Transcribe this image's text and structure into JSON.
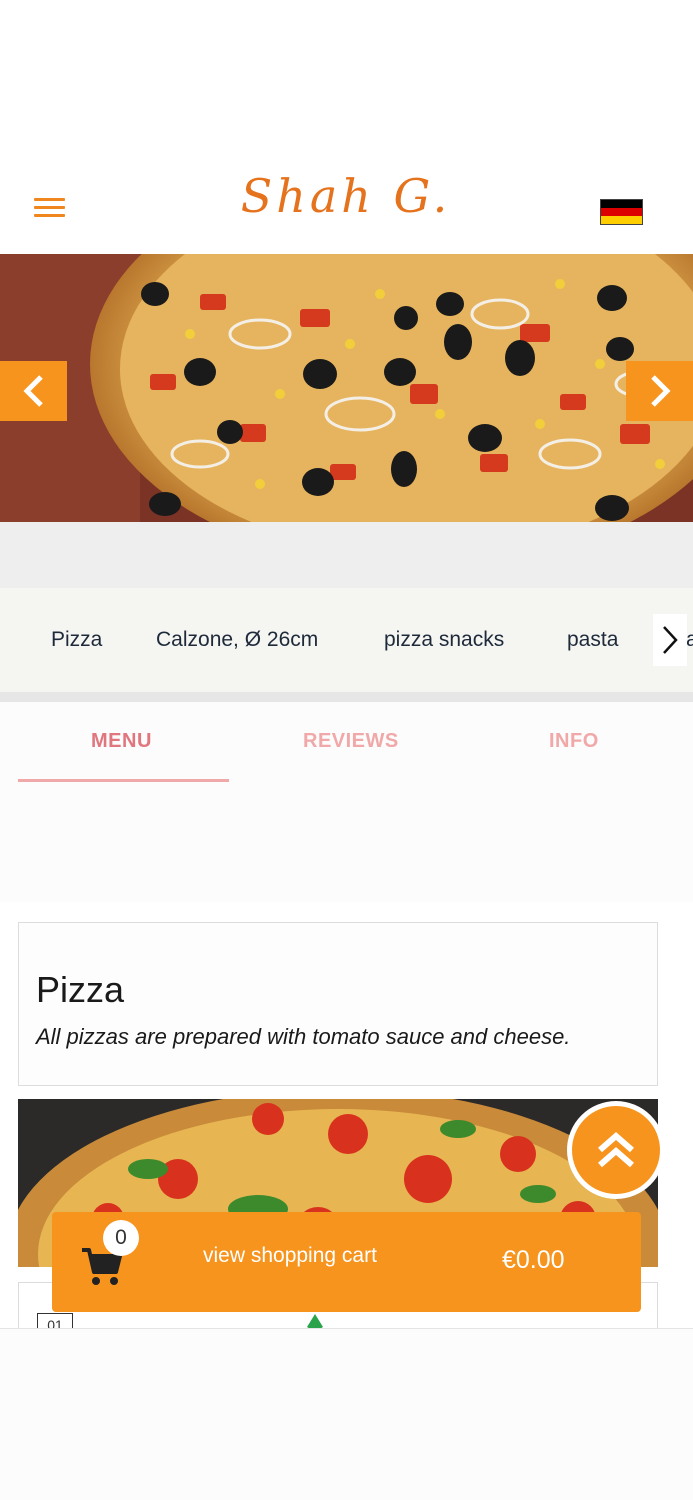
{
  "header": {
    "logo_text": "Shah G.",
    "flag_colors": [
      "#000000",
      "#dd0000",
      "#ffce00"
    ]
  },
  "slider": {
    "prev_icon": "chevron-left-icon",
    "next_icon": "chevron-right-icon"
  },
  "categories": {
    "items": [
      "Pizza",
      "Calzone, Ø 26cm",
      "pizza snacks",
      "pasta"
    ],
    "peek": "a",
    "next_icon": "chevron-right-icon"
  },
  "tabs": {
    "menu": "MENU",
    "reviews": "REVIEWS",
    "info": "INFO"
  },
  "section": {
    "title": "Pizza",
    "description": "All pizzas are prepared with tomato sauce and cheese."
  },
  "item": {
    "number": "01"
  },
  "cart": {
    "count": "0",
    "label": "view shopping cart",
    "total": "€0.00"
  },
  "colors": {
    "accent": "#f7941d",
    "logo": "#e5731e",
    "tab_active": "#e0777e",
    "tab_inactive": "#f0a8a8"
  }
}
